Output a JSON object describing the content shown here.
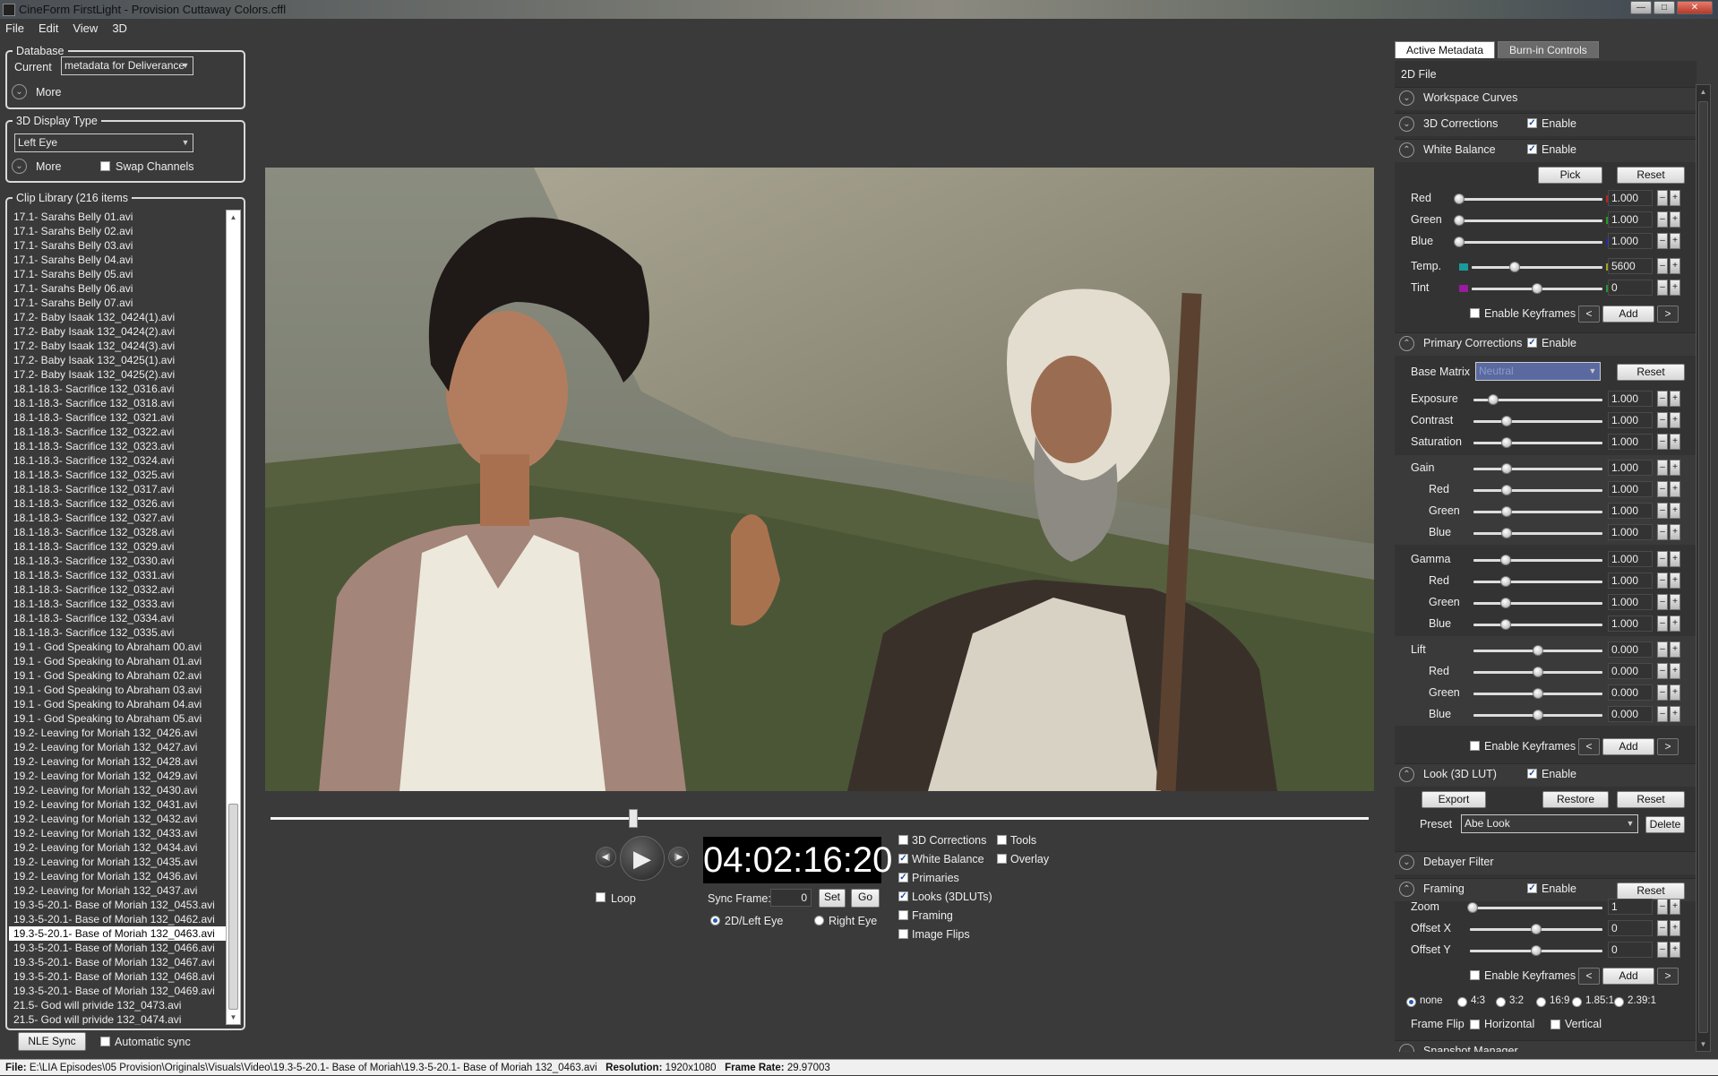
{
  "window": {
    "title": "CineForm FirstLight - Provision Cuttaway Colors.cffl"
  },
  "menu": [
    "File",
    "Edit",
    "View",
    "3D"
  ],
  "database": {
    "legend": "Database",
    "current_label": "Current",
    "current_value": "metadata for Deliverance",
    "more": "More"
  },
  "display3d": {
    "legend": "3D Display Type",
    "value": "Left Eye",
    "more": "More",
    "swap": "Swap Channels"
  },
  "clip_library": {
    "legend": "Clip Library (216 items",
    "selected_index": 50,
    "items": [
      "17.1- Sarahs Belly 01.avi",
      "17.1- Sarahs Belly 02.avi",
      "17.1- Sarahs Belly 03.avi",
      "17.1- Sarahs Belly 04.avi",
      "17.1- Sarahs Belly 05.avi",
      "17.1- Sarahs Belly 06.avi",
      "17.1- Sarahs Belly 07.avi",
      "17.2- Baby Isaak 132_0424(1).avi",
      "17.2- Baby Isaak 132_0424(2).avi",
      "17.2- Baby Isaak 132_0424(3).avi",
      "17.2- Baby Isaak 132_0425(1).avi",
      "17.2- Baby Isaak 132_0425(2).avi",
      "18.1-18.3- Sacrifice  132_0316.avi",
      "18.1-18.3- Sacrifice  132_0318.avi",
      "18.1-18.3- Sacrifice  132_0321.avi",
      "18.1-18.3- Sacrifice  132_0322.avi",
      "18.1-18.3- Sacrifice  132_0323.avi",
      "18.1-18.3- Sacrifice  132_0324.avi",
      "18.1-18.3- Sacrifice  132_0325.avi",
      "18.1-18.3- Sacrifice 132_0317.avi",
      "18.1-18.3- Sacrifice 132_0326.avi",
      "18.1-18.3- Sacrifice 132_0327.avi",
      "18.1-18.3- Sacrifice 132_0328.avi",
      "18.1-18.3- Sacrifice 132_0329.avi",
      "18.1-18.3- Sacrifice 132_0330.avi",
      "18.1-18.3- Sacrifice 132_0331.avi",
      "18.1-18.3- Sacrifice 132_0332.avi",
      "18.1-18.3- Sacrifice 132_0333.avi",
      "18.1-18.3- Sacrifice 132_0334.avi",
      "18.1-18.3- Sacrifice 132_0335.avi",
      "19.1 - God Speaking to Abraham 00.avi",
      "19.1 - God Speaking to Abraham 01.avi",
      "19.1 - God Speaking to Abraham 02.avi",
      "19.1 - God Speaking to Abraham 03.avi",
      "19.1 - God Speaking to Abraham 04.avi",
      "19.1 - God Speaking to Abraham 05.avi",
      "19.2- Leaving for Moriah 132_0426.avi",
      "19.2- Leaving for Moriah 132_0427.avi",
      "19.2- Leaving for Moriah 132_0428.avi",
      "19.2- Leaving for Moriah 132_0429.avi",
      "19.2- Leaving for Moriah 132_0430.avi",
      "19.2- Leaving for Moriah 132_0431.avi",
      "19.2- Leaving for Moriah 132_0432.avi",
      "19.2- Leaving for Moriah 132_0433.avi",
      "19.2- Leaving for Moriah 132_0434.avi",
      "19.2- Leaving for Moriah 132_0435.avi",
      "19.2- Leaving for Moriah 132_0436.avi",
      "19.2- Leaving for Moriah 132_0437.avi",
      "19.3-5-20.1- Base of Moriah 132_0453.avi",
      "19.3-5-20.1- Base of Moriah 132_0462.avi",
      "19.3-5-20.1- Base of Moriah 132_0463.avi",
      "19.3-5-20.1- Base of Moriah 132_0466.avi",
      "19.3-5-20.1- Base of Moriah 132_0467.avi",
      "19.3-5-20.1- Base of Moriah 132_0468.avi",
      "19.3-5-20.1- Base of Moriah 132_0469.avi",
      "21.5- God will privide 132_0473.avi",
      "21.5- God will privide 132_0474.avi"
    ]
  },
  "nle": {
    "button": "NLE Sync",
    "auto": "Automatic sync"
  },
  "transport": {
    "timecode": "04:02:16:20",
    "loop": "Loop",
    "sync_label": "Sync Frame:",
    "sync_value": "0",
    "set": "Set",
    "go": "Go",
    "eye_left": "2D/Left Eye",
    "eye_right": "Right Eye",
    "playhead": 0.33
  },
  "toggles": [
    {
      "label": "3D Corrections",
      "checked": false
    },
    {
      "label": "White  Balance",
      "checked": true
    },
    {
      "label": "Primaries",
      "checked": true
    },
    {
      "label": "Looks (3DLUTs)",
      "checked": true
    },
    {
      "label": "Framing",
      "checked": false
    },
    {
      "label": "Image Flips",
      "checked": false
    }
  ],
  "toggles2": [
    {
      "label": "Tools",
      "checked": false
    },
    {
      "label": "Overlay",
      "checked": false
    }
  ],
  "right": {
    "tab_active": "Active Metadata",
    "tab_other": "Burn-in Controls",
    "header": "2D File",
    "workspace": "Workspace Curves",
    "corr3d": "3D Corrections",
    "enable": "Enable",
    "wb": {
      "title": "White Balance",
      "pick": "Pick",
      "reset": "Reset",
      "red": "Red",
      "green": "Green",
      "blue": "Blue",
      "temp": "Temp.",
      "tint": "Tint",
      "red_v": "1.000",
      "green_v": "1.000",
      "blue_v": "1.000",
      "temp_v": "5600",
      "tint_v": "0",
      "keyframes": "Enable Keyframes",
      "add": "Add",
      "prev": "<",
      "next": ">"
    },
    "primary": {
      "title": "Primary Corrections",
      "base_matrix": "Base Matrix",
      "base_value": "Neutral",
      "reset": "Reset",
      "exposure": "Exposure",
      "contrast": "Contrast",
      "saturation": "Saturation",
      "gain": "Gain",
      "gamma": "Gamma",
      "lift": "Lift",
      "red": "Red",
      "green": "Green",
      "blue": "Blue",
      "one": "1.000",
      "zero": "0.000"
    },
    "look": {
      "title": "Look (3D LUT)",
      "export": "Export",
      "restore": "Restore",
      "reset": "Reset",
      "preset": "Preset",
      "preset_value": "Abe Look",
      "delete": "Delete"
    },
    "debayer": "Debayer Filter",
    "framing": {
      "title": "Framing",
      "reset": "Reset",
      "zoom": "Zoom",
      "offx": "Offset X",
      "offy": "Offset Y",
      "zoom_v": "1",
      "offx_v": "0",
      "offy_v": "0"
    },
    "aspects": [
      "none",
      "4:3",
      "3:2",
      "16:9",
      "1.85:1",
      "2.39:1"
    ],
    "flip": {
      "label": "Frame Flip",
      "h": "Horizontal",
      "v": "Vertical"
    },
    "snapshot": "Snapshot Manager"
  },
  "status": {
    "file_label": "File:",
    "file": "E:\\LIA Episodes\\05 Provision\\Originals\\Visuals\\Video\\19.3-5-20.1- Base of Moriah\\19.3-5-20.1- Base of Moriah 132_0463.avi",
    "res_label": "Resolution:",
    "res": "1920x1080",
    "fr_label": "Frame Rate:",
    "fr": "29.97003"
  }
}
